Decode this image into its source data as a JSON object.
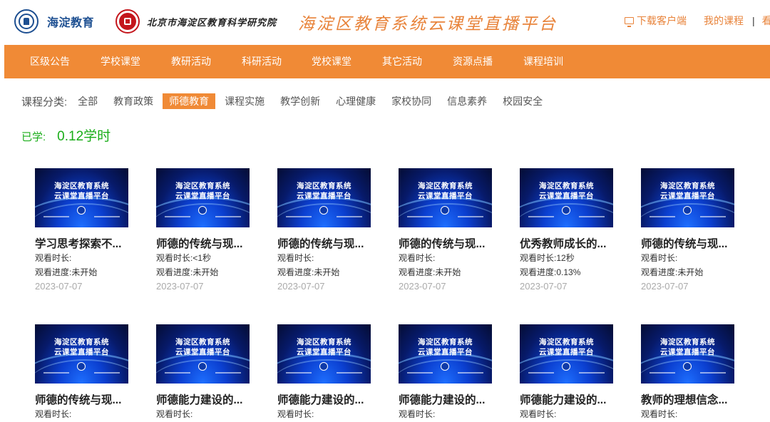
{
  "header": {
    "logo1_text": "海淀教育",
    "logo2_text": "北京市海淀区教育科学研究院",
    "platform_title": "海淀区教育系统云课堂直播平台",
    "download_label": "下载客户端",
    "my_courses_label": "我的课程",
    "separator": "|",
    "cut_off_link": "看"
  },
  "nav": {
    "items": [
      "区级公告",
      "学校课堂",
      "教研活动",
      "科研活动",
      "党校课堂",
      "其它活动",
      "资源点播",
      "课程培训"
    ]
  },
  "filter": {
    "label": "课程分类:",
    "chips": [
      "全部",
      "教育政策",
      "师德教育",
      "课程实施",
      "教学创新",
      "心理健康",
      "家校协同",
      "信息素养",
      "校园安全"
    ],
    "active_index": 2
  },
  "studied": {
    "label": "已学:",
    "value": "0.12学时"
  },
  "thumbnail": {
    "line1": "海淀区教育系统",
    "line2": "云课堂直播平台"
  },
  "cards": [
    {
      "title": "学习思考探索不...",
      "duration_label": "观看时长:",
      "duration": "",
      "progress_label": "观看进度:",
      "progress": "未开始",
      "date": "2023-07-07"
    },
    {
      "title": "师德的传统与现...",
      "duration_label": "观看时长:",
      "duration": "<1秒",
      "progress_label": "观看进度:",
      "progress": "未开始",
      "date": "2023-07-07"
    },
    {
      "title": "师德的传统与现...",
      "duration_label": "观看时长:",
      "duration": "",
      "progress_label": "观看进度:",
      "progress": "未开始",
      "date": "2023-07-07"
    },
    {
      "title": "师德的传统与现...",
      "duration_label": "观看时长:",
      "duration": "",
      "progress_label": "观看进度:",
      "progress": "未开始",
      "date": "2023-07-07"
    },
    {
      "title": "优秀教师成长的...",
      "duration_label": "观看时长:",
      "duration": "12秒",
      "progress_label": "观看进度:",
      "progress": "0.13%",
      "date": "2023-07-07"
    },
    {
      "title": "师德的传统与现...",
      "duration_label": "观看时长:",
      "duration": "",
      "progress_label": "观看进度:",
      "progress": "未开始",
      "date": "2023-07-07"
    },
    {
      "title": "师德的传统与现...",
      "duration_label": "观看时长:",
      "duration": ""
    },
    {
      "title": "师德能力建设的...",
      "duration_label": "观看时长:",
      "duration": ""
    },
    {
      "title": "师德能力建设的...",
      "duration_label": "观看时长:",
      "duration": ""
    },
    {
      "title": "师德能力建设的...",
      "duration_label": "观看时长:",
      "duration": ""
    },
    {
      "title": "师德能力建设的...",
      "duration_label": "观看时长:",
      "duration": ""
    },
    {
      "title": "教师的理想信念...",
      "duration_label": "观看时长:",
      "duration": ""
    }
  ]
}
